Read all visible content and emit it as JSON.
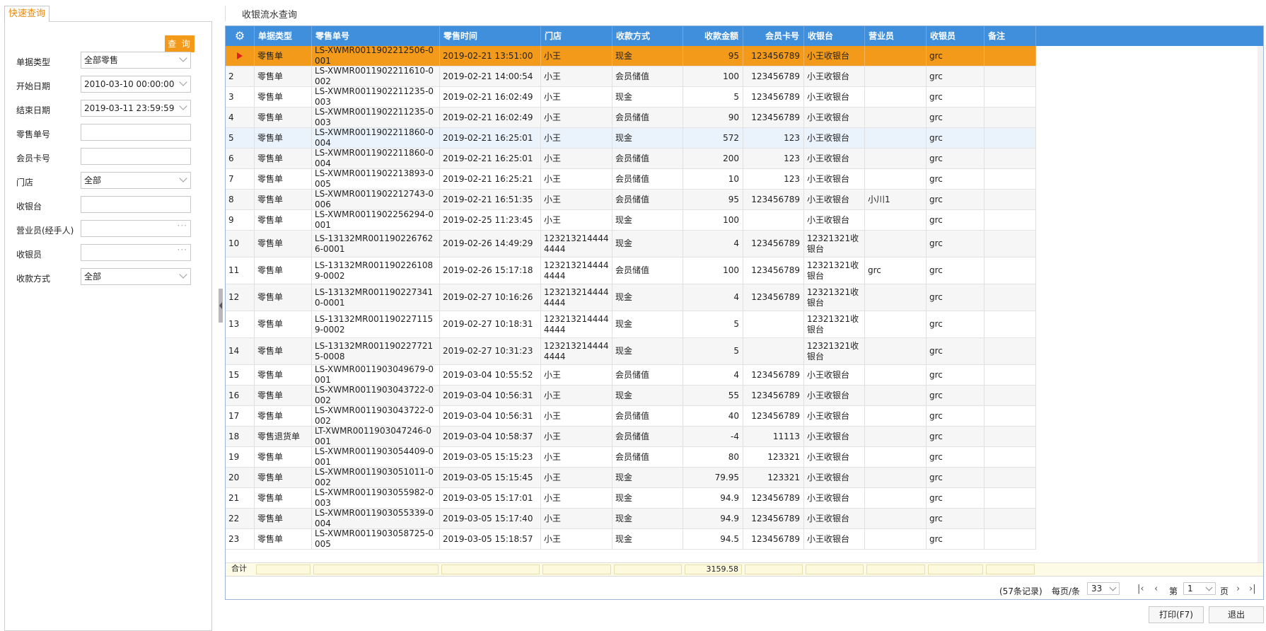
{
  "left": {
    "tab_label": "快速查询",
    "query_button": "查 询",
    "fields": [
      {
        "label": "单据类型",
        "value": "全部零售",
        "kind": "select"
      },
      {
        "label": "开始日期",
        "value": "2010-03-10 00:00:00",
        "kind": "select"
      },
      {
        "label": "结束日期",
        "value": "2019-03-11 23:59:59",
        "kind": "select"
      },
      {
        "label": "零售单号",
        "value": "",
        "kind": "text"
      },
      {
        "label": "会员卡号",
        "value": "",
        "kind": "text"
      },
      {
        "label": "门店",
        "value": "全部",
        "kind": "select"
      },
      {
        "label": "收银台",
        "value": "",
        "kind": "text"
      },
      {
        "label": "营业员(经手人)",
        "value": "",
        "kind": "lookup"
      },
      {
        "label": "收银员",
        "value": "",
        "kind": "lookup"
      },
      {
        "label": "收款方式",
        "value": "全部",
        "kind": "select"
      }
    ]
  },
  "page_title": "收银流水查询",
  "grid": {
    "columns": [
      "单据类型",
      "零售单号",
      "零售时间",
      "门店",
      "收款方式",
      "收款金额",
      "会员卡号",
      "收银台",
      "营业员",
      "收银员",
      "备注"
    ],
    "rows": [
      [
        "",
        "零售单",
        "LS-XWMR0011902212506-0001",
        "2019-02-21 13:51:00",
        "小王",
        "现金",
        "95",
        "123456789",
        "小王收银台",
        "",
        "grc",
        ""
      ],
      [
        "2",
        "零售单",
        "LS-XWMR0011902211610-0002",
        "2019-02-21 14:00:54",
        "小王",
        "会员储值",
        "100",
        "123456789",
        "小王收银台",
        "",
        "grc",
        ""
      ],
      [
        "3",
        "零售单",
        "LS-XWMR0011902211235-0003",
        "2019-02-21 16:02:49",
        "小王",
        "现金",
        "5",
        "123456789",
        "小王收银台",
        "",
        "grc",
        ""
      ],
      [
        "4",
        "零售单",
        "LS-XWMR0011902211235-0003",
        "2019-02-21 16:02:49",
        "小王",
        "会员储值",
        "90",
        "123456789",
        "小王收银台",
        "",
        "grc",
        ""
      ],
      [
        "5",
        "零售单",
        "LS-XWMR0011902211860-0004",
        "2019-02-21 16:25:01",
        "小王",
        "现金",
        "572",
        "123",
        "小王收银台",
        "",
        "grc",
        ""
      ],
      [
        "6",
        "零售单",
        "LS-XWMR0011902211860-0004",
        "2019-02-21 16:25:01",
        "小王",
        "会员储值",
        "200",
        "123",
        "小王收银台",
        "",
        "grc",
        ""
      ],
      [
        "7",
        "零售单",
        "LS-XWMR0011902213893-0005",
        "2019-02-21 16:25:21",
        "小王",
        "会员储值",
        "10",
        "123",
        "小王收银台",
        "",
        "grc",
        ""
      ],
      [
        "8",
        "零售单",
        "LS-XWMR0011902212743-0006",
        "2019-02-21 16:51:35",
        "小王",
        "会员储值",
        "95",
        "123456789",
        "小王收银台",
        "小川1",
        "grc",
        ""
      ],
      [
        "9",
        "零售单",
        "LS-XWMR0011902256294-0001",
        "2019-02-25 11:23:45",
        "小王",
        "现金",
        "100",
        "",
        "小王收银台",
        "",
        "grc",
        ""
      ],
      [
        "10",
        "零售单",
        "LS-13132MR0011902267626-0001",
        "2019-02-26 14:49:29",
        "1232132144444444",
        "现金",
        "4",
        "123456789",
        "12321321收银台",
        "",
        "grc",
        ""
      ],
      [
        "11",
        "零售单",
        "LS-13132MR0011902261089-0002",
        "2019-02-26 15:17:18",
        "1232132144444444",
        "会员储值",
        "100",
        "123456789",
        "12321321收银台",
        "grc",
        "grc",
        ""
      ],
      [
        "12",
        "零售单",
        "LS-13132MR0011902273410-0001",
        "2019-02-27 10:16:26",
        "1232132144444444",
        "现金",
        "4",
        "123456789",
        "12321321收银台",
        "",
        "grc",
        ""
      ],
      [
        "13",
        "零售单",
        "LS-13132MR0011902271159-0002",
        "2019-02-27 10:18:31",
        "1232132144444444",
        "现金",
        "5",
        "",
        "12321321收银台",
        "",
        "grc",
        ""
      ],
      [
        "14",
        "零售单",
        "LS-13132MR0011902277215-0008",
        "2019-02-27 10:31:23",
        "1232132144444444",
        "现金",
        "5",
        "",
        "12321321收银台",
        "",
        "grc",
        ""
      ],
      [
        "15",
        "零售单",
        "LS-XWMR0011903049679-0001",
        "2019-03-04 10:55:52",
        "小王",
        "会员储值",
        "4",
        "123456789",
        "小王收银台",
        "",
        "grc",
        ""
      ],
      [
        "16",
        "零售单",
        "LS-XWMR0011903043722-0002",
        "2019-03-04 10:56:31",
        "小王",
        "现金",
        "55",
        "123456789",
        "小王收银台",
        "",
        "grc",
        ""
      ],
      [
        "17",
        "零售单",
        "LS-XWMR0011903043722-0002",
        "2019-03-04 10:56:31",
        "小王",
        "会员储值",
        "40",
        "123456789",
        "小王收银台",
        "",
        "grc",
        ""
      ],
      [
        "18",
        "零售退货单",
        "LT-XWMR0011903047246-0001",
        "2019-03-04 10:58:37",
        "小王",
        "会员储值",
        "-4",
        "11113",
        "小王收银台",
        "",
        "grc",
        ""
      ],
      [
        "19",
        "零售单",
        "LS-XWMR0011903054409-0001",
        "2019-03-05 15:15:23",
        "小王",
        "会员储值",
        "80",
        "123321",
        "小王收银台",
        "",
        "grc",
        ""
      ],
      [
        "20",
        "零售单",
        "LS-XWMR0011903051011-0002",
        "2019-03-05 15:15:45",
        "小王",
        "现金",
        "79.95",
        "123321",
        "小王收银台",
        "",
        "grc",
        ""
      ],
      [
        "21",
        "零售单",
        "LS-XWMR0011903055982-0003",
        "2019-03-05 15:17:01",
        "小王",
        "现金",
        "94.9",
        "123456789",
        "小王收银台",
        "",
        "grc",
        ""
      ],
      [
        "22",
        "零售单",
        "LS-XWMR0011903055339-0004",
        "2019-03-05 15:17:40",
        "小王",
        "现金",
        "94.9",
        "123456789",
        "小王收银台",
        "",
        "grc",
        ""
      ],
      [
        "23",
        "零售单",
        "LS-XWMR0011903058725-0005",
        "2019-03-05 15:18:57",
        "小王",
        "现金",
        "94.5",
        "123456789",
        "小王收银台",
        "",
        "grc",
        ""
      ]
    ],
    "selected_row": 0,
    "summary_label": "合计",
    "summary_amount": "3159.58"
  },
  "pager": {
    "records": "(57条记录)",
    "per_page_label": "每页/条",
    "per_page": "33",
    "page_prefix": "第",
    "page": "1",
    "page_suffix": "页"
  },
  "buttons": {
    "print": "打印(F7)",
    "exit": "退出"
  },
  "colors": {
    "header": "#3f8fdc",
    "selected": "#f39a1a",
    "accent": "#e8890c"
  }
}
